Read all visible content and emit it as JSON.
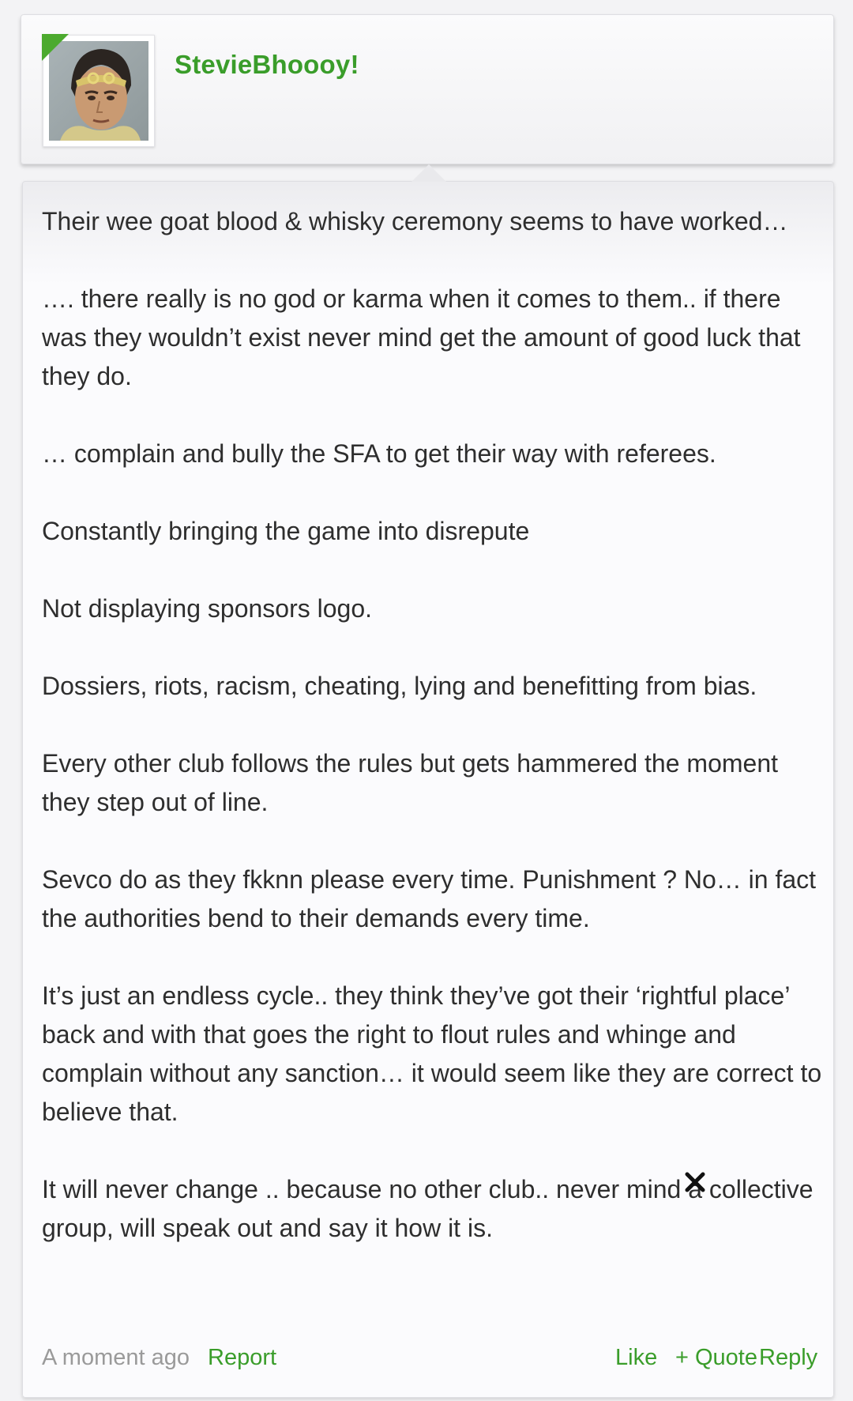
{
  "post": {
    "username": "StevieBhoooy!",
    "paragraphs": [
      "Their wee goat blood & whisky ceremony seems to have worked…",
      "…. there really is no god or karma when it comes to them.. if there was they wouldn’t exist never mind get the amount of good luck that they do.",
      "… complain and bully the SFA to get their way with referees.",
      "Constantly bringing the game into disrepute",
      "Not displaying sponsors logo.",
      "Dossiers, riots, racism, cheating, lying and benefitting from bias.",
      "Every other club follows the rules but gets hammered the moment they step out of line.",
      "Sevco do as they fkknn please every time. Punishment ? No… in fact the authorities bend to their demands every time.",
      "It’s just an endless cycle.. they think they’ve got their ‘rightful place’ back and with that goes the right to flout rules and whinge and complain without any sanction… it would seem like they are correct to believe that.",
      "It will never change .. because no other club.. never mind a collective group, will speak out and say it how it is."
    ],
    "footer": {
      "timestamp": "A moment ago",
      "report": "Report",
      "like": "Like",
      "quote": "+ Quote",
      "reply": "Reply"
    }
  },
  "icons": {
    "corner_badge": "green-corner-icon",
    "dismiss": "close-icon"
  },
  "colors": {
    "accent": "#3a9d2a",
    "text": "#2e2e2e",
    "muted": "#9a9a9a"
  }
}
